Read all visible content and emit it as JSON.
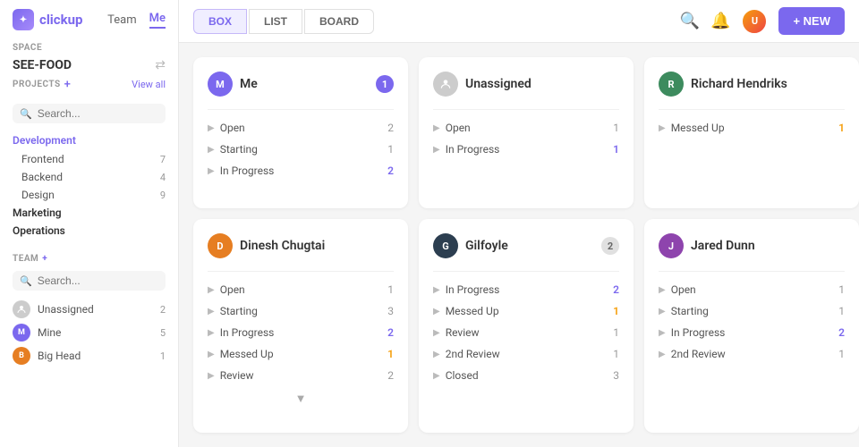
{
  "app": {
    "name": "clickup"
  },
  "topbar": {
    "views": [
      "BOX",
      "LIST",
      "BOARD"
    ],
    "active_view": "BOX",
    "new_button_label": "+ NEW"
  },
  "sidebar": {
    "space_label": "SPACE",
    "space_name": "SEE-FOOD",
    "projects_label": "PROJECTS",
    "view_all_label": "View all",
    "search_placeholder": "Search...",
    "group_label": "Development",
    "items": [
      {
        "label": "Frontend",
        "count": "7"
      },
      {
        "label": "Backend",
        "count": "4"
      },
      {
        "label": "Design",
        "count": "9"
      }
    ],
    "marketing_label": "Marketing",
    "operations_label": "Operations",
    "team_label": "TEAM",
    "team_members": [
      {
        "name": "Unassigned",
        "count": "2",
        "color": "#aaa"
      },
      {
        "name": "Mine",
        "count": "5",
        "color": "#7b68ee"
      },
      {
        "name": "Big Head",
        "count": "1",
        "color": "#e67e22"
      }
    ]
  },
  "board": {
    "cards": [
      {
        "id": "me",
        "username": "Me",
        "avatar_color": "#7b68ee",
        "avatar_text": "M",
        "badge": "1",
        "badge_type": "purple",
        "rows": [
          {
            "label": "Open",
            "count": "2",
            "count_style": "normal"
          },
          {
            "label": "Starting",
            "count": "1",
            "count_style": "normal"
          },
          {
            "label": "In Progress",
            "count": "2",
            "count_style": "purple"
          }
        ],
        "has_expand": false
      },
      {
        "id": "unassigned",
        "username": "Unassigned",
        "avatar_color": "#ccc",
        "avatar_text": "?",
        "badge": "",
        "badge_type": "none",
        "rows": [
          {
            "label": "Open",
            "count": "1",
            "count_style": "normal"
          },
          {
            "label": "In Progress",
            "count": "1",
            "count_style": "purple"
          }
        ],
        "has_expand": false
      },
      {
        "id": "richard",
        "username": "Richard Hendriks",
        "avatar_color": "#3d8b5e",
        "avatar_text": "R",
        "badge": "",
        "badge_type": "none",
        "rows": [
          {
            "label": "Messed Up",
            "count": "1",
            "count_style": "orange"
          }
        ],
        "has_expand": false
      },
      {
        "id": "dinesh",
        "username": "Dinesh Chugtai",
        "avatar_color": "#e67e22",
        "avatar_text": "D",
        "badge": "",
        "badge_type": "none",
        "rows": [
          {
            "label": "Open",
            "count": "1",
            "count_style": "normal"
          },
          {
            "label": "Starting",
            "count": "3",
            "count_style": "normal"
          },
          {
            "label": "In Progress",
            "count": "2",
            "count_style": "purple"
          },
          {
            "label": "Messed Up",
            "count": "1",
            "count_style": "orange"
          },
          {
            "label": "Review",
            "count": "2",
            "count_style": "normal"
          }
        ],
        "has_expand": true
      },
      {
        "id": "gilfoyle",
        "username": "Gilfoyle",
        "avatar_color": "#2c3e50",
        "avatar_text": "G",
        "badge": "2",
        "badge_type": "gray",
        "rows": [
          {
            "label": "In Progress",
            "count": "2",
            "count_style": "purple"
          },
          {
            "label": "Messed Up",
            "count": "1",
            "count_style": "orange"
          },
          {
            "label": "Review",
            "count": "1",
            "count_style": "normal"
          },
          {
            "label": "2nd Review",
            "count": "1",
            "count_style": "normal"
          },
          {
            "label": "Closed",
            "count": "3",
            "count_style": "normal"
          }
        ],
        "has_expand": false
      },
      {
        "id": "jared",
        "username": "Jared Dunn",
        "avatar_color": "#8e44ad",
        "avatar_text": "J",
        "badge": "",
        "badge_type": "none",
        "rows": [
          {
            "label": "Open",
            "count": "1",
            "count_style": "normal"
          },
          {
            "label": "Starting",
            "count": "1",
            "count_style": "normal"
          },
          {
            "label": "In Progress",
            "count": "2",
            "count_style": "purple"
          },
          {
            "label": "2nd Review",
            "count": "1",
            "count_style": "normal"
          }
        ],
        "has_expand": false
      }
    ]
  }
}
